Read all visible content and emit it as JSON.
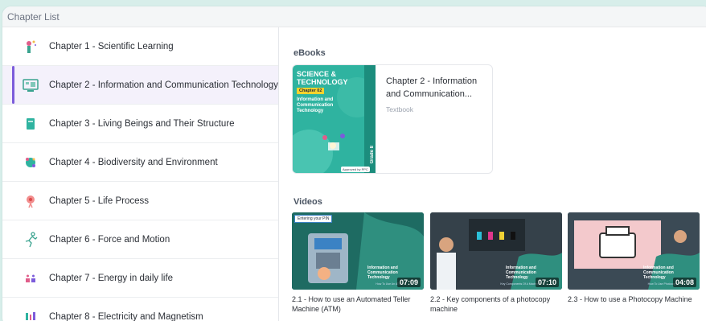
{
  "panel": {
    "title": "Chapter List"
  },
  "sidebar": {
    "items": [
      {
        "label": "Chapter 1 - Scientific Learning",
        "icon": "microscope-icon"
      },
      {
        "label": "Chapter 2 - Information and Communication Technology",
        "icon": "computer-icon",
        "active": true
      },
      {
        "label": "Chapter 3 - Living Beings and Their Structure",
        "icon": "book-icon"
      },
      {
        "label": "Chapter 4 - Biodiversity and Environment",
        "icon": "globe-icon"
      },
      {
        "label": "Chapter 5 - Life Process",
        "icon": "cell-icon"
      },
      {
        "label": "Chapter 6 - Force and Motion",
        "icon": "runner-icon"
      },
      {
        "label": "Chapter 7 - Energy in daily life",
        "icon": "energy-icon"
      },
      {
        "label": "Chapter 8 - Electricity and Magnetism",
        "icon": "magnet-icon"
      }
    ]
  },
  "ebooks": {
    "section_label": "eBooks",
    "items": [
      {
        "title": "Chapter 2 - Information and Communication...",
        "type": "Textbook",
        "cover": {
          "title_line1": "SCIENCE &",
          "title_line2": "TECHNOLOGY",
          "chapter_tag": "Chapter 02",
          "subtitle": "Information and Communication Technology",
          "grade": "Grade 8",
          "publisher": "Approved by PPC"
        }
      }
    ]
  },
  "videos": {
    "section_label": "Videos",
    "items": [
      {
        "title": "2.1 - How to use an Automated Teller Machine (ATM)",
        "duration": "07:09",
        "overlay": "Information and Communication Technology",
        "overlay_sub": "How To Use An ATM",
        "badge": "Entering your PIN"
      },
      {
        "title": "2.2 - Key components of a photocopy machine",
        "duration": "07:10",
        "overlay": "Information and Communication Technology",
        "overlay_sub": "Key Components Of A Machine",
        "badge": ""
      },
      {
        "title": "2.3 - How to use a Photocopy Machine",
        "duration": "04:08",
        "overlay": "Information and Communication Technology",
        "overlay_sub": "How To Use Photocopy",
        "badge": ""
      }
    ]
  },
  "colors": {
    "accent": "#7c5cdb",
    "teal": "#2fb3a0",
    "background": "#d7eeea"
  }
}
